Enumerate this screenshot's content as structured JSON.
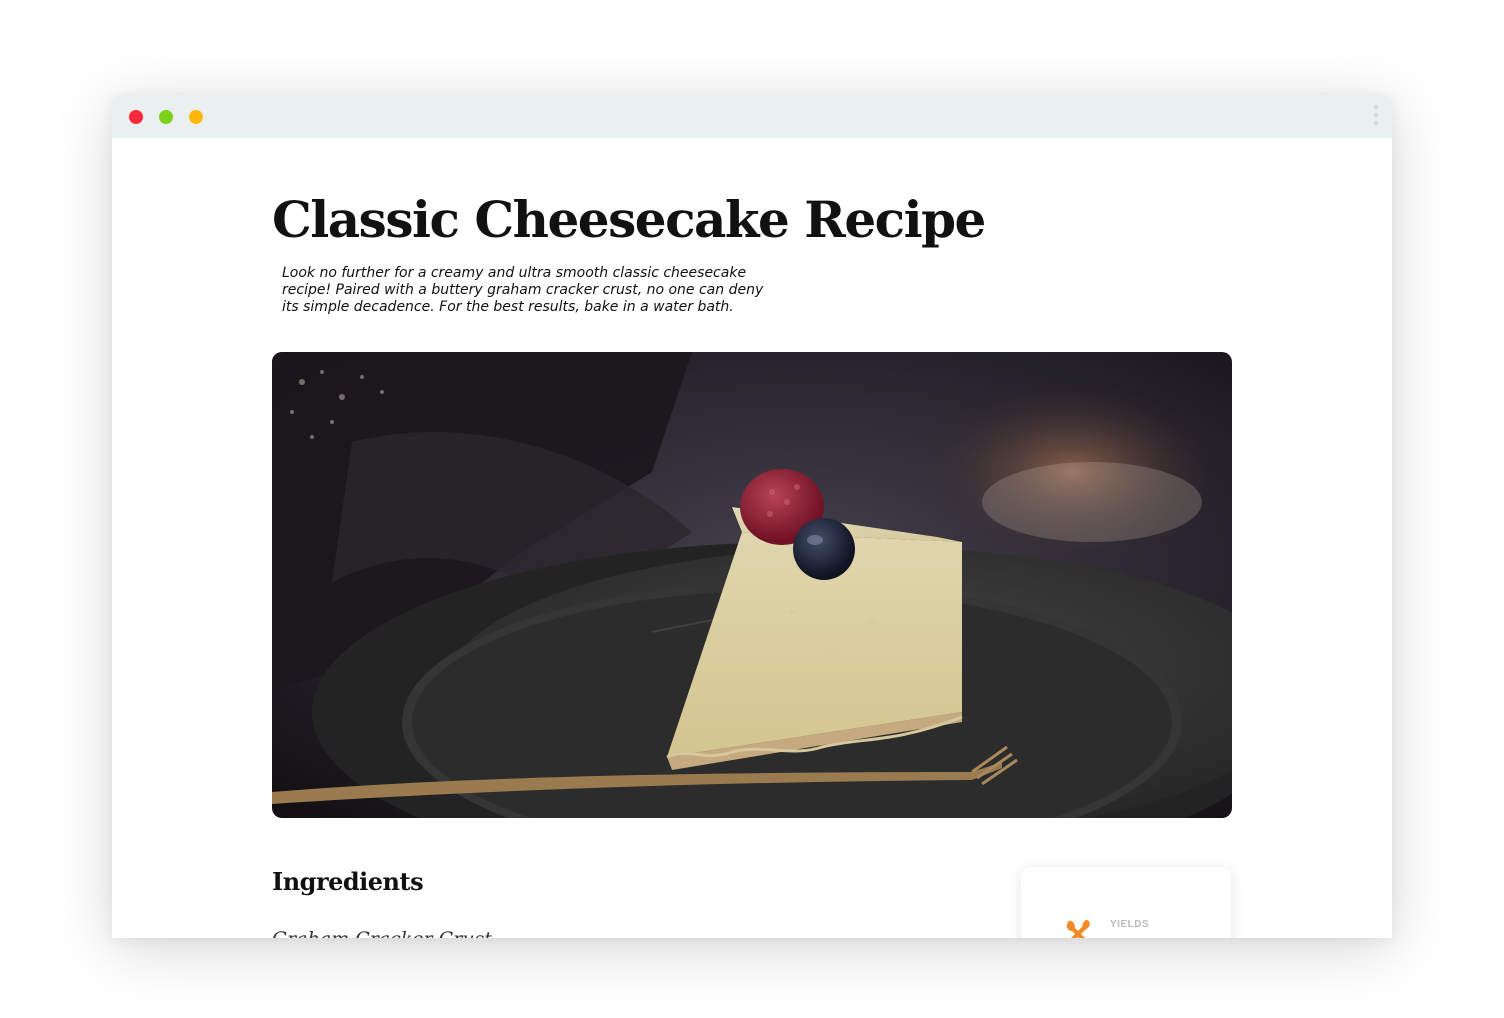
{
  "window": {
    "controls": [
      "close-button",
      "maximize-button",
      "minimize-button"
    ],
    "menu_icon": "vertical-ellipsis-icon"
  },
  "recipe": {
    "title": "Classic Cheesecake Recipe",
    "description": "Look no further for a creamy and ultra smooth classic cheesecake recipe! Paired with a buttery graham cracker crust, no one can deny its simple decadence. For the best results, bake in a water bath.",
    "hero_image_alt": "cheesecake-slice-photo",
    "ingredients_heading": "Ingredients",
    "ingredients_subheading": "Graham Cracker Crust"
  },
  "info_card": {
    "label": "YIELDS",
    "value": "",
    "icon": "utensils-icon"
  },
  "colors": {
    "close": "#fc2a3c",
    "maximize": "#7cd11a",
    "minimize": "#feb80a",
    "titlebar": "#eaf0f0",
    "accent": "#f08a24"
  }
}
